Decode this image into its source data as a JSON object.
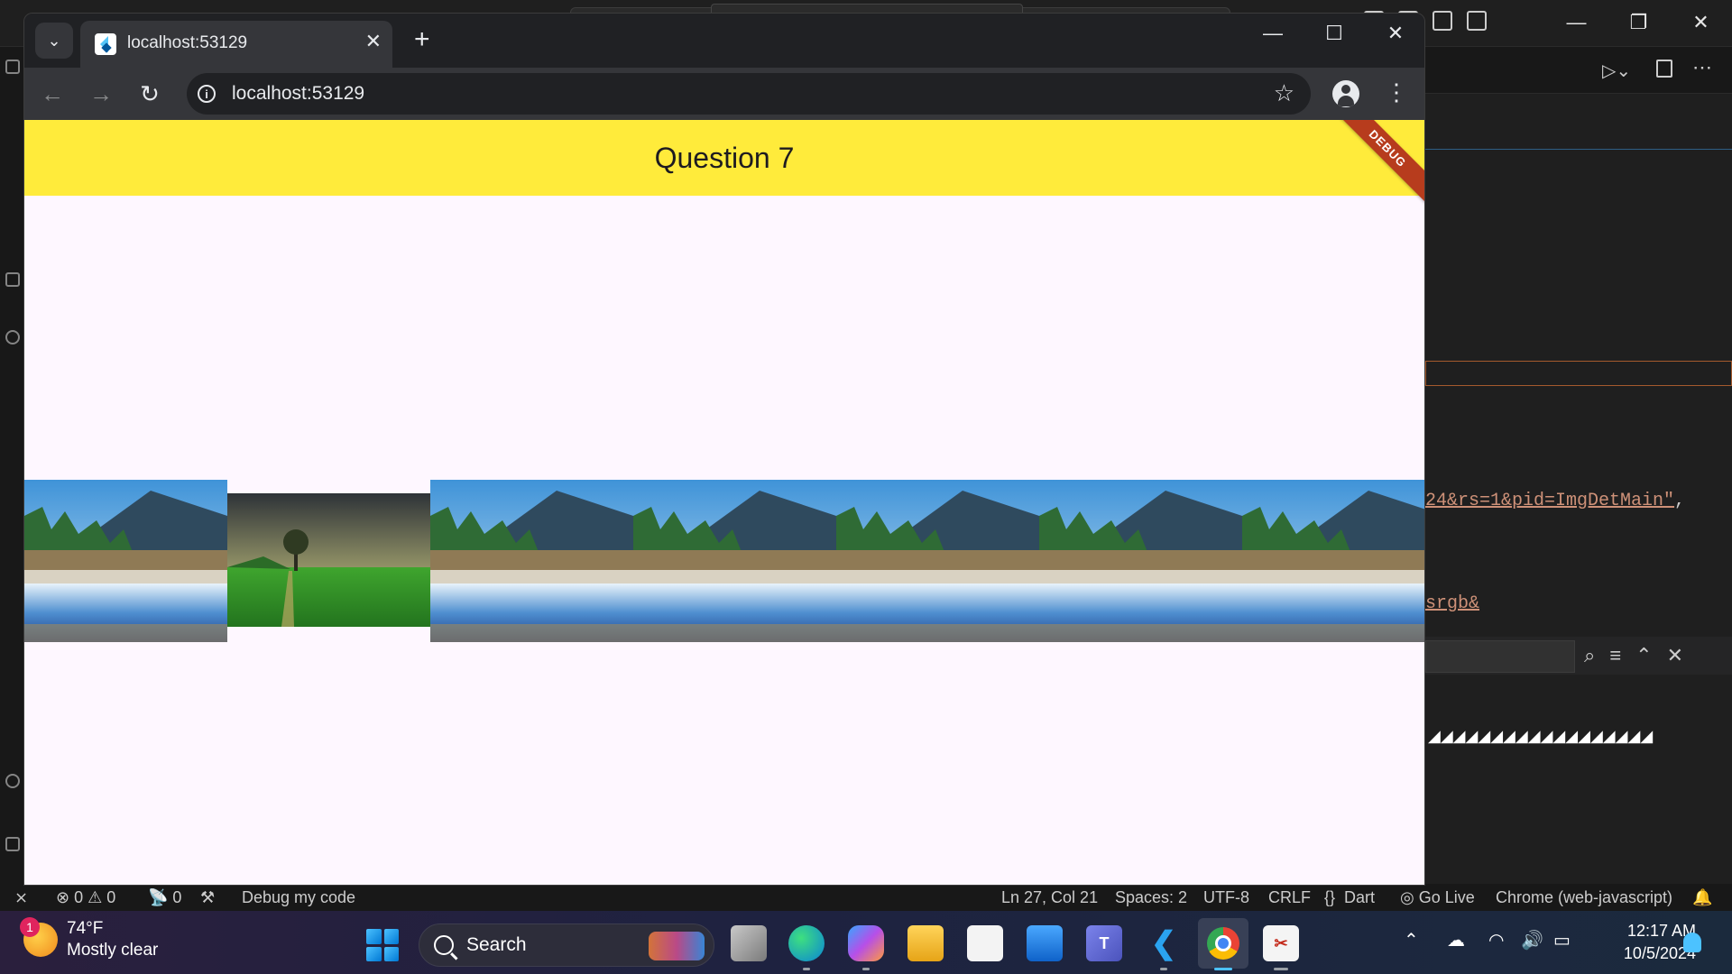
{
  "vscode": {
    "code_line_1": "24&rs=1&pid=ImgDetMain\",",
    "code_line_1_string": "24&rs=1&pid=ImgDetMain\"",
    "code_line_1_punct": ",",
    "code_line_2": "srgb&",
    "status": {
      "errors": "0",
      "warnings": "0",
      "ports": "0",
      "debug_label": "Debug my code",
      "position": "Ln 27, Col 21",
      "spaces": "Spaces: 2",
      "encoding": "UTF-8",
      "eol": "CRLF",
      "language": "Dart",
      "golive": "Go Live",
      "device": "Chrome (web-javascript)"
    }
  },
  "browser": {
    "tab_title": "localhost:53129",
    "url": "localhost:53129"
  },
  "app": {
    "title": "Question 7",
    "debug_banner": "DEBUG",
    "images": [
      "waterfall",
      "meadow",
      "waterfall",
      "waterfall",
      "waterfall",
      "waterfall",
      "waterfall"
    ]
  },
  "taskbar": {
    "weather_temp": "74°F",
    "weather_desc": "Mostly clear",
    "weather_badge": "1",
    "search_label": "Search",
    "time": "12:17 AM",
    "date": "10/5/2024"
  },
  "colors": {
    "appbar": "#ffeb3b",
    "app_background": "#fef7ff",
    "debug_banner": "#b73c1d",
    "chrome_frame": "#202124",
    "chrome_toolbar": "#35363a"
  }
}
